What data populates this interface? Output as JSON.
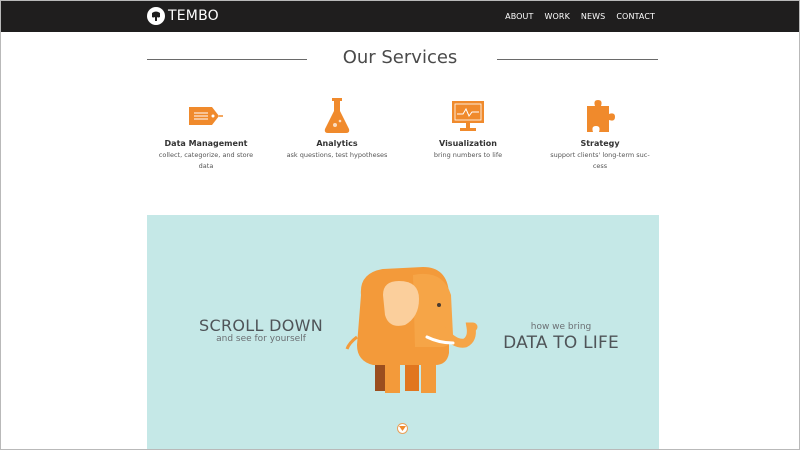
{
  "header": {
    "brand": "TEMBO",
    "nav": [
      "ABOUT",
      "WORK",
      "NEWS",
      "CONTACT"
    ]
  },
  "services": {
    "title": "Our Services",
    "items": [
      {
        "icon": "tag-icon",
        "name": "Data Management",
        "desc": "collect, categorize, and store data"
      },
      {
        "icon": "flask-icon",
        "name": "Analytics",
        "desc": "ask questions, test hypotheses"
      },
      {
        "icon": "monitor-chart-icon",
        "name": "Visualization",
        "desc": "bring numbers to life"
      },
      {
        "icon": "puzzle-piece-icon",
        "name": "Strategy",
        "desc": "support clients' long-term suc-cess"
      }
    ]
  },
  "hero": {
    "left_big": "SCROLL DOWN",
    "left_small": "and see for yourself",
    "right_small": "how we bring",
    "right_big": "DATA TO LIFE",
    "scroll_icon": "chevron-down-icon"
  },
  "colors": {
    "accent": "#f08a2c",
    "topbar": "#1f1e1e",
    "hero_bg": "#c5e8e7",
    "text_dark": "#4f5458"
  }
}
